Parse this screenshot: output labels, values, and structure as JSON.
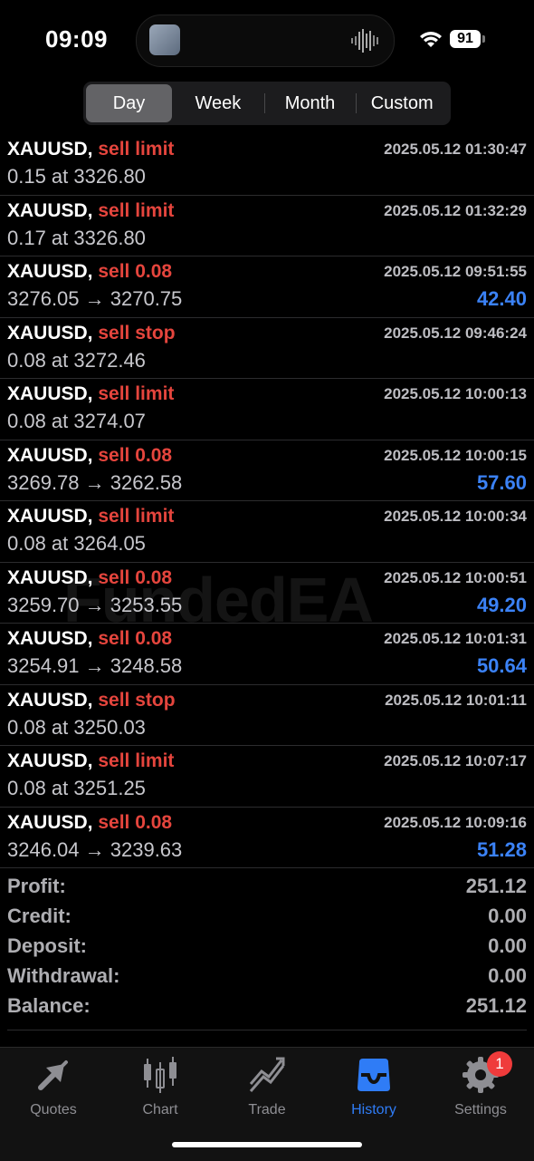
{
  "status_bar": {
    "time": "09:09",
    "battery": "91"
  },
  "segments": [
    {
      "label": "Day",
      "active": true
    },
    {
      "label": "Week",
      "active": false
    },
    {
      "label": "Month",
      "active": false
    },
    {
      "label": "Custom",
      "active": false
    }
  ],
  "orders": [
    {
      "symbol": "XAUUSD,",
      "action": "sell limit",
      "timestamp": "2025.05.12 01:30:47",
      "detail": "0.15 at 3326.80",
      "profit": ""
    },
    {
      "symbol": "XAUUSD,",
      "action": "sell limit",
      "timestamp": "2025.05.12 01:32:29",
      "detail": "0.17 at 3326.80",
      "profit": ""
    },
    {
      "symbol": "XAUUSD,",
      "action": "sell 0.08",
      "timestamp": "2025.05.12 09:51:55",
      "detail": "3276.05 → 3270.75",
      "profit": "42.40"
    },
    {
      "symbol": "XAUUSD,",
      "action": "sell stop",
      "timestamp": "2025.05.12 09:46:24",
      "detail": "0.08 at 3272.46",
      "profit": ""
    },
    {
      "symbol": "XAUUSD,",
      "action": "sell limit",
      "timestamp": "2025.05.12 10:00:13",
      "detail": "0.08 at 3274.07",
      "profit": ""
    },
    {
      "symbol": "XAUUSD,",
      "action": "sell 0.08",
      "timestamp": "2025.05.12 10:00:15",
      "detail": "3269.78 → 3262.58",
      "profit": "57.60"
    },
    {
      "symbol": "XAUUSD,",
      "action": "sell limit",
      "timestamp": "2025.05.12 10:00:34",
      "detail": "0.08 at 3264.05",
      "profit": ""
    },
    {
      "symbol": "XAUUSD,",
      "action": "sell 0.08",
      "timestamp": "2025.05.12 10:00:51",
      "detail": "3259.70 → 3253.55",
      "profit": "49.20"
    },
    {
      "symbol": "XAUUSD,",
      "action": "sell 0.08",
      "timestamp": "2025.05.12 10:01:31",
      "detail": "3254.91 → 3248.58",
      "profit": "50.64"
    },
    {
      "symbol": "XAUUSD,",
      "action": "sell stop",
      "timestamp": "2025.05.12 10:01:11",
      "detail": "0.08 at 3250.03",
      "profit": ""
    },
    {
      "symbol": "XAUUSD,",
      "action": "sell limit",
      "timestamp": "2025.05.12 10:07:17",
      "detail": "0.08 at 3251.25",
      "profit": ""
    },
    {
      "symbol": "XAUUSD,",
      "action": "sell 0.08",
      "timestamp": "2025.05.12 10:09:16",
      "detail": "3246.04 → 3239.63",
      "profit": "51.28"
    }
  ],
  "watermark": "FundedEA",
  "summary": [
    {
      "label": "Profit:",
      "value": "251.12"
    },
    {
      "label": "Credit:",
      "value": "0.00"
    },
    {
      "label": "Deposit:",
      "value": "0.00"
    },
    {
      "label": "Withdrawal:",
      "value": "0.00"
    },
    {
      "label": "Balance:",
      "value": "251.12"
    }
  ],
  "tabs": [
    {
      "label": "Quotes",
      "icon": "quotes-arrows-icon",
      "active": false
    },
    {
      "label": "Chart",
      "icon": "candlestick-icon",
      "active": false
    },
    {
      "label": "Trade",
      "icon": "trend-line-icon",
      "active": false
    },
    {
      "label": "History",
      "icon": "inbox-tray-icon",
      "active": true
    },
    {
      "label": "Settings",
      "icon": "gear-icon",
      "active": false,
      "badge": "1"
    }
  ],
  "colors": {
    "sell": "#e5453d",
    "profit": "#3b82f6",
    "active_tab": "#2f7cf6",
    "badge": "#ef3b3b"
  }
}
